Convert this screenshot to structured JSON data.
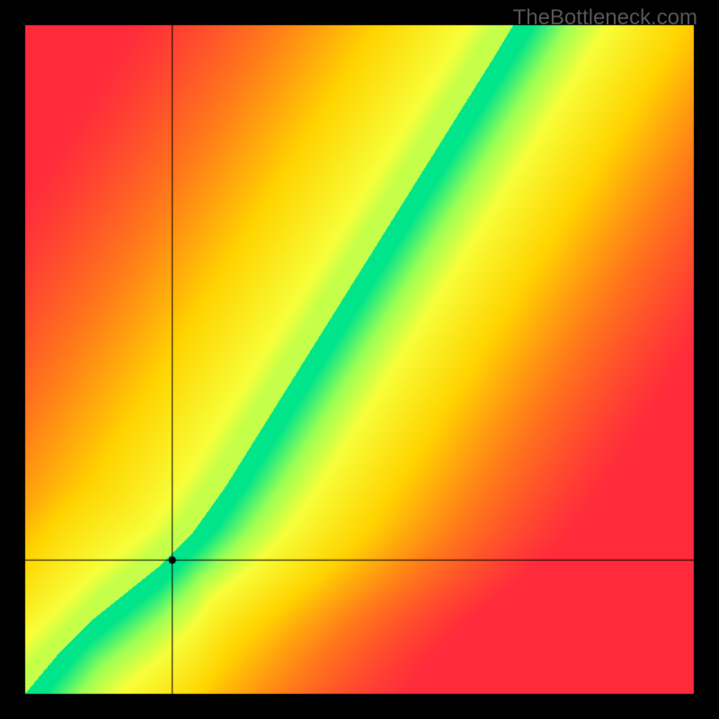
{
  "watermark": "TheBottleneck.com",
  "chart_data": {
    "type": "heatmap",
    "title": "",
    "xlabel": "",
    "ylabel": "",
    "x_range": [
      0,
      100
    ],
    "y_range": [
      0,
      100
    ],
    "outer_size_px": 800,
    "border_px": 28,
    "border_color": "#000000",
    "grid": false,
    "crosshair": {
      "x": 22,
      "y": 20
    },
    "marker": {
      "x": 22,
      "y": 20,
      "shape": "circle",
      "color": "#000000",
      "radius_px": 4
    },
    "optimal_curve": [
      {
        "x": 0,
        "y": 0
      },
      {
        "x": 5,
        "y": 6
      },
      {
        "x": 10,
        "y": 11
      },
      {
        "x": 15,
        "y": 15
      },
      {
        "x": 20,
        "y": 19
      },
      {
        "x": 25,
        "y": 24
      },
      {
        "x": 30,
        "y": 31
      },
      {
        "x": 35,
        "y": 39
      },
      {
        "x": 40,
        "y": 47
      },
      {
        "x": 45,
        "y": 55
      },
      {
        "x": 50,
        "y": 63
      },
      {
        "x": 55,
        "y": 71
      },
      {
        "x": 60,
        "y": 79
      },
      {
        "x": 65,
        "y": 87
      },
      {
        "x": 70,
        "y": 95
      },
      {
        "x": 73,
        "y": 100
      }
    ],
    "color_stops": [
      {
        "t": 0.0,
        "color": "#ff2a3c"
      },
      {
        "t": 0.25,
        "color": "#ff7a1a"
      },
      {
        "t": 0.5,
        "color": "#ffd400"
      },
      {
        "t": 0.75,
        "color": "#f7ff3a"
      },
      {
        "t": 0.88,
        "color": "#9bff55"
      },
      {
        "t": 1.0,
        "color": "#00e58a"
      }
    ],
    "green_band_half_width": 3.0,
    "falloff_scale": 55.0
  }
}
